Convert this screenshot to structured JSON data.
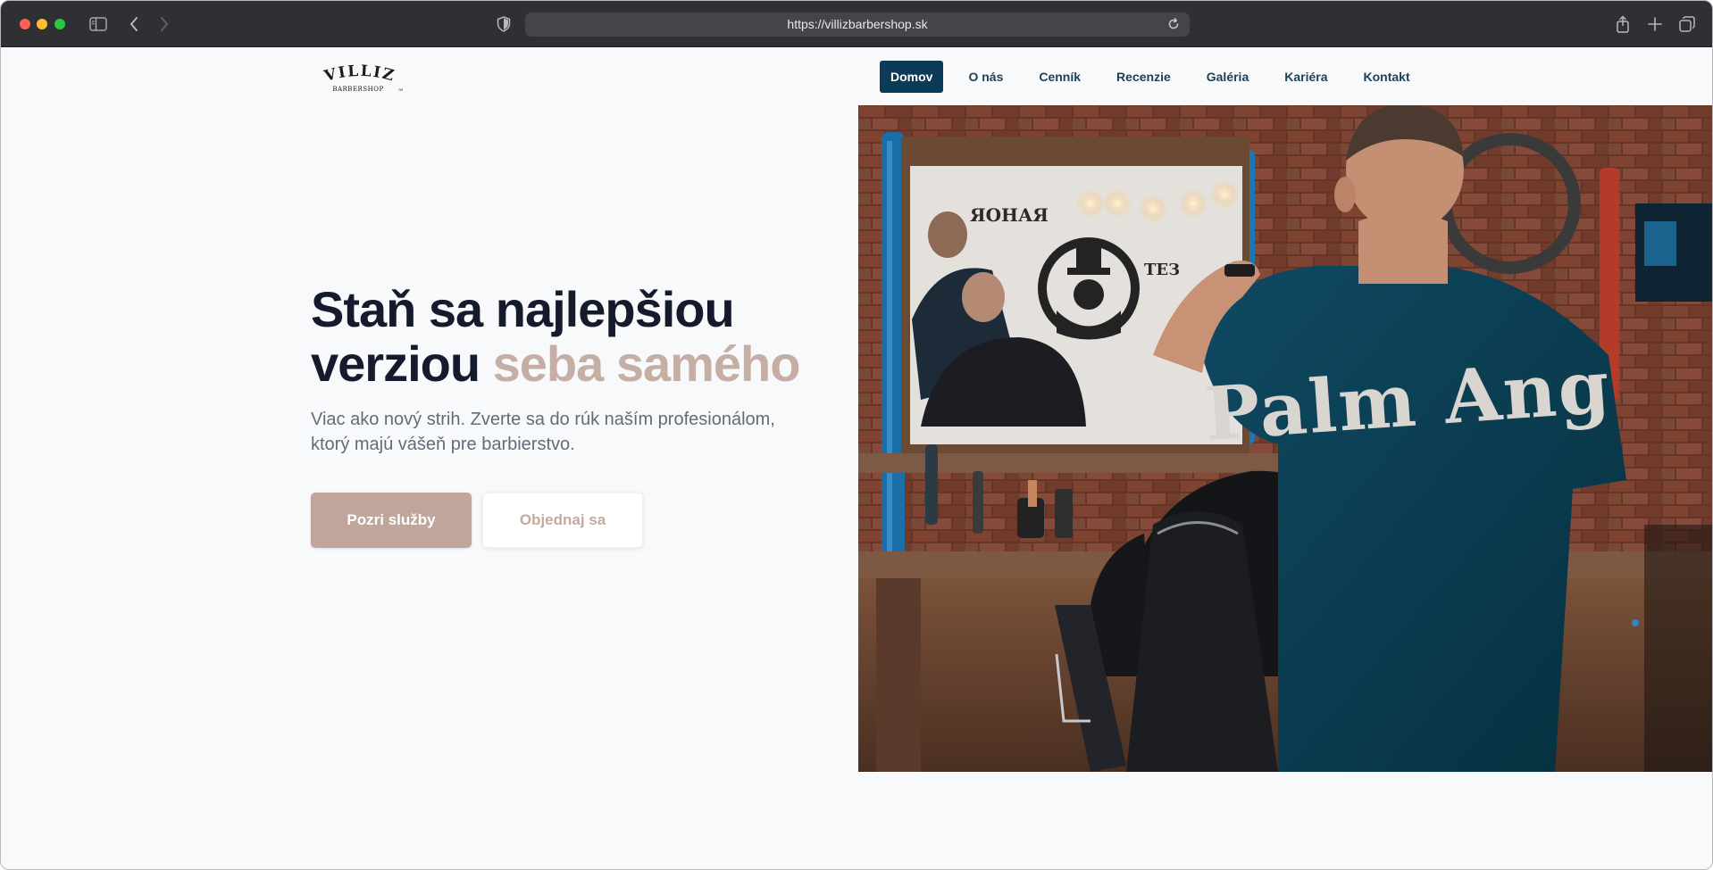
{
  "browser": {
    "url": "https://villizbarbershop.sk"
  },
  "logo": {
    "top_text": "VILLIZ",
    "bottom_text": "BARBERSHOP",
    "mark": "TM"
  },
  "nav": {
    "items": [
      {
        "label": "Domov",
        "active": true
      },
      {
        "label": "O nás"
      },
      {
        "label": "Cenník"
      },
      {
        "label": "Recenzie"
      },
      {
        "label": "Galéria"
      },
      {
        "label": "Kariéra"
      },
      {
        "label": "Kontakt"
      }
    ]
  },
  "hero": {
    "headline_part1": "Staň sa najlepšiou verziou ",
    "headline_accent": "seba samého",
    "subtext": "Viac ako nový strih. Zverte sa do rúk naším profesionálom, ktorý majú vášeň pre barbierstvo.",
    "primary_button": "Pozri služby",
    "secondary_button": "Objednaj sa",
    "image_shirt_text": "Palm Ang",
    "image": "barber-photo"
  },
  "colors": {
    "nav_active": "#0b3b57",
    "accent": "#c5aea4",
    "primary_button": "#bfa59a",
    "headline": "#141b2d"
  }
}
